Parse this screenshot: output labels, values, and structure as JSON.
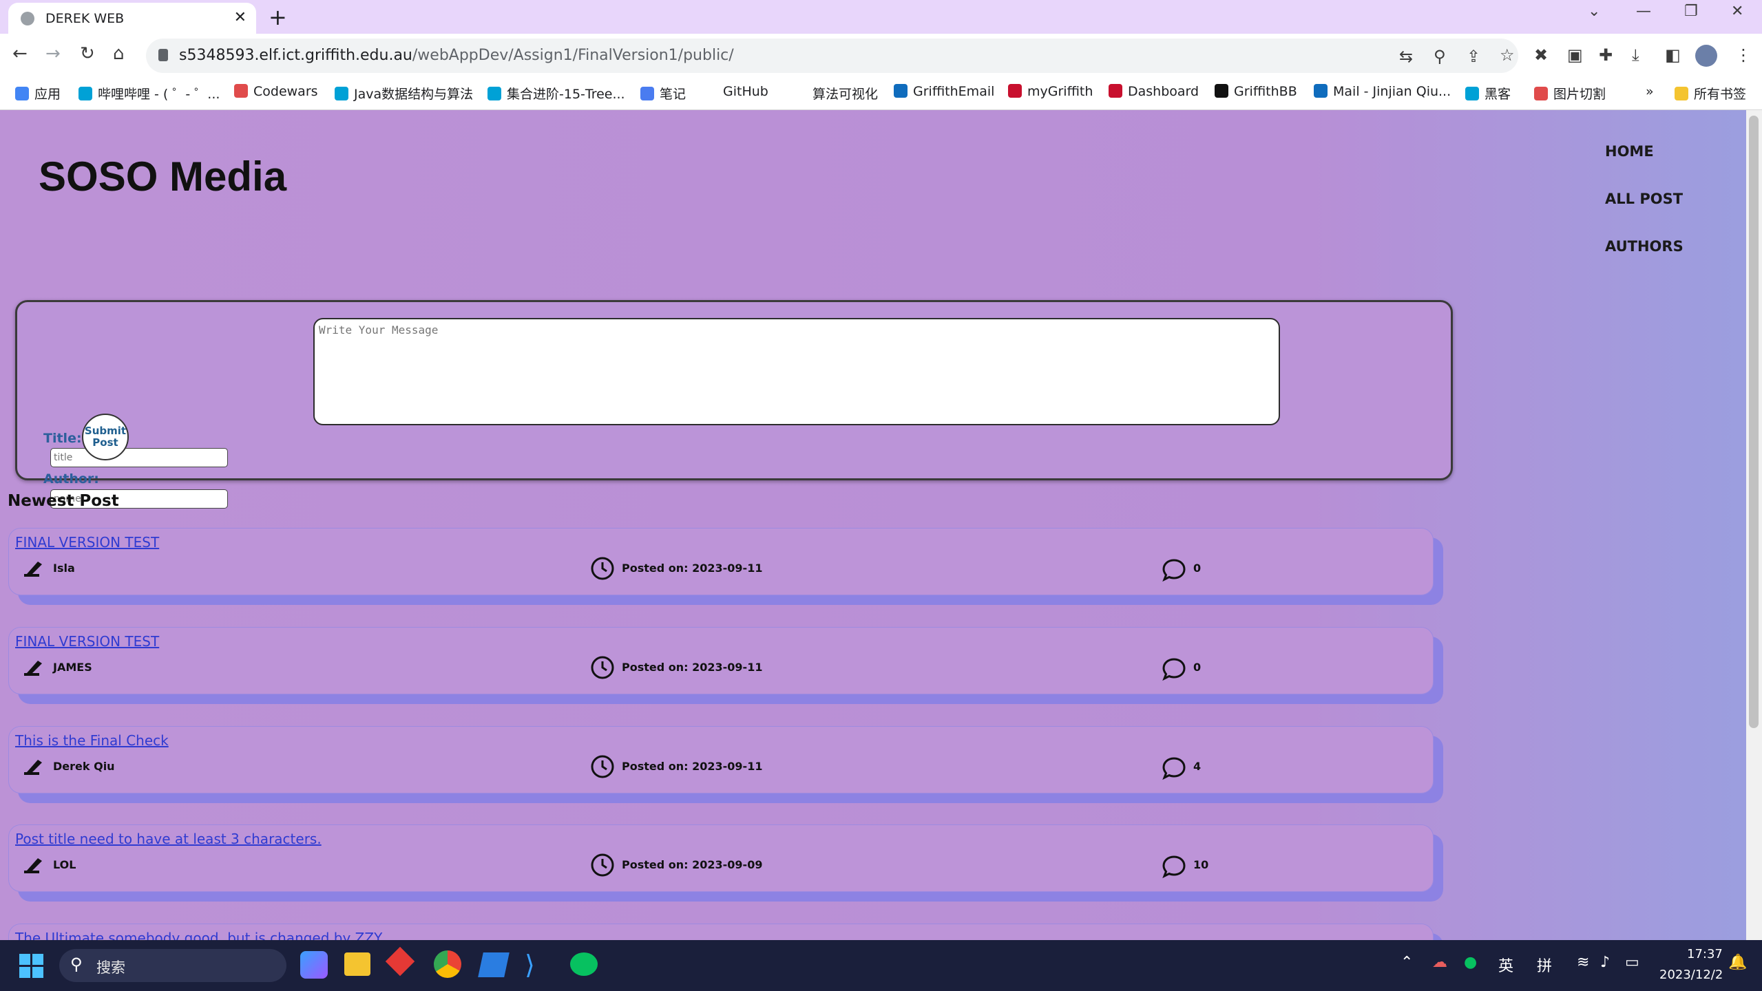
{
  "browser": {
    "tab_title": "DEREK WEB",
    "tab_close": "✕",
    "new_tab": "+",
    "url_host": "s5348593.elf.ict.griffith.edu.au",
    "url_path": "/webAppDev/Assign1/FinalVersion1/public/"
  },
  "bookmarks": [
    {
      "label": "应用",
      "color": "#4285f4"
    },
    {
      "label": "哔哩哔哩 - ( ゜- ゜...",
      "color": "#00a1d6"
    },
    {
      "label": "Codewars",
      "color": "#e04b4b"
    },
    {
      "label": "Java数据结构与算法",
      "color": "#00a1d6"
    },
    {
      "label": "集合进阶-15-Tree...",
      "color": "#00a1d6"
    },
    {
      "label": "笔记",
      "color": "#4a7cf0"
    },
    {
      "label": "GitHub",
      "color": ""
    },
    {
      "label": "算法可视化",
      "color": ""
    },
    {
      "label": "GriffithEmail",
      "color": "#0f6cbd"
    },
    {
      "label": "myGriffith",
      "color": "#c8102e"
    },
    {
      "label": "Dashboard",
      "color": "#c8102e"
    },
    {
      "label": "GriffithBB",
      "color": "#111111"
    },
    {
      "label": "Mail - Jinjian Qiu...",
      "color": "#0f6cbd"
    },
    {
      "label": "黑客",
      "color": "#00a1d6"
    },
    {
      "label": "图片切割",
      "color": "#e04b4b"
    }
  ],
  "bookmarks_more": "»",
  "bookmarks_folder": "所有书签",
  "site": {
    "title": "SOSO Media",
    "nav": [
      "HOME",
      "ALL POST",
      "AUTHORS"
    ]
  },
  "form": {
    "title_label": "Title:",
    "title_placeholder": "title",
    "author_label": "Author:",
    "author_placeholder": "name",
    "submit_line1": "Submit",
    "submit_line2": "Post",
    "message_placeholder": "Write Your Message"
  },
  "newest_heading": "Newest Post",
  "posts": [
    {
      "title": "FINAL VERSION TEST",
      "author": "Isla",
      "date": "Posted on: 2023-09-11",
      "comments": "0"
    },
    {
      "title": "FINAL VERSION TEST",
      "author": "JAMES",
      "date": "Posted on: 2023-09-11",
      "comments": "0"
    },
    {
      "title": "This is the Final Check",
      "author": "Derek Qiu",
      "date": "Posted on: 2023-09-11",
      "comments": "4"
    },
    {
      "title": "Post title need to have at least 3 characters.",
      "author": "LOL",
      "date": "Posted on: 2023-09-09",
      "comments": "10"
    },
    {
      "title": "The Ultimate somebody good, but is changed by ZZY",
      "author": "",
      "date": "",
      "comments": ""
    }
  ],
  "taskbar": {
    "search_label": "搜索",
    "ime_lang": "英",
    "ime_mode": "拼",
    "time": "17:37",
    "date": "2023/12/2"
  }
}
